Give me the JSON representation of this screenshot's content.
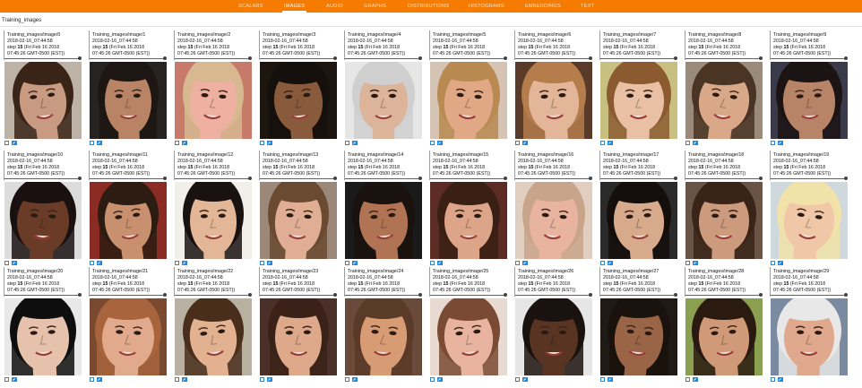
{
  "nav": {
    "tabs": [
      {
        "label": "SCALARS",
        "active": false
      },
      {
        "label": "IMAGES",
        "active": true
      },
      {
        "label": "AUDIO",
        "active": false
      },
      {
        "label": "GRAPHS",
        "active": false
      },
      {
        "label": "DISTRIBUTIONS",
        "active": false
      },
      {
        "label": "HISTOGRAMS",
        "active": false
      },
      {
        "label": "EMBEDDINGS",
        "active": false
      },
      {
        "label": "TEXT",
        "active": false
      }
    ]
  },
  "group": {
    "title": "Training_images"
  },
  "card_common": {
    "wall_time": "2018-02-16_07:44:58",
    "step_label": "step",
    "step_value": "15",
    "time_detail": "(Fri Feb 16 2018",
    "time_zone": "07:45:26 GMT-0500 (EST))"
  },
  "colors": {
    "accent": "#f57c00",
    "control": "#1e88e5"
  },
  "icons": {
    "fit": "expand-icon",
    "actual": "actual-size-icon"
  },
  "cards": [
    {
      "tag": "Training_images/image/0",
      "bg": "#bdb2a6",
      "skin": "#c89a82",
      "hair": "#3a2418"
    },
    {
      "tag": "Training_images/image/1",
      "bg": "#262321",
      "skin": "#b98466",
      "hair": "#1d1612"
    },
    {
      "tag": "Training_images/image/2",
      "bg": "#c87a6a",
      "skin": "#eeb0a0",
      "hair": "#d7b890"
    },
    {
      "tag": "Training_images/image/3",
      "bg": "#1c1510",
      "skin": "#8a5a3c",
      "hair": "#15100c"
    },
    {
      "tag": "Training_images/image/4",
      "bg": "#e6e6e6",
      "skin": "#dcb49a",
      "hair": "#cfcfcf"
    },
    {
      "tag": "Training_images/image/5",
      "bg": "#d5c4b4",
      "skin": "#e0a884",
      "hair": "#b88a52"
    },
    {
      "tag": "Training_images/image/6",
      "bg": "#5a3a28",
      "skin": "#e3b69a",
      "hair": "#b57c4c"
    },
    {
      "tag": "Training_images/image/7",
      "bg": "#c8c080",
      "skin": "#e9c0a4",
      "hair": "#8c5a30"
    },
    {
      "tag": "Training_images/image/8",
      "bg": "#9a8a7a",
      "skin": "#d8a888",
      "hair": "#4a3424"
    },
    {
      "tag": "Training_images/image/9",
      "bg": "#3a3a4a",
      "skin": "#b88468",
      "hair": "#1c1414"
    },
    {
      "tag": "Training_images/image/10",
      "bg": "#dcdcdc",
      "skin": "#6a3c28",
      "hair": "#1a1010"
    },
    {
      "tag": "Training_images/image/11",
      "bg": "#8a2c24",
      "skin": "#c8906e",
      "hair": "#2c1c12"
    },
    {
      "tag": "Training_images/image/12",
      "bg": "#f0efe9",
      "skin": "#e2b696",
      "hair": "#1a1210"
    },
    {
      "tag": "Training_images/image/13",
      "bg": "#9c8878",
      "skin": "#dfae94",
      "hair": "#6a4a30"
    },
    {
      "tag": "Training_images/image/14",
      "bg": "#1a1a1a",
      "skin": "#b07454",
      "hair": "#1a120e"
    },
    {
      "tag": "Training_images/image/15",
      "bg": "#5c2c24",
      "skin": "#dca488",
      "hair": "#3a2014"
    },
    {
      "tag": "Training_images/image/16",
      "bg": "#e0cfc0",
      "skin": "#e8b4a0",
      "hair": "#c8a48a"
    },
    {
      "tag": "Training_images/image/17",
      "bg": "#2a2a2a",
      "skin": "#d8aa8c",
      "hair": "#140e0c"
    },
    {
      "tag": "Training_images/image/18",
      "bg": "#6a5446",
      "skin": "#cc9a7c",
      "hair": "#3a2418"
    },
    {
      "tag": "Training_images/image/19",
      "bg": "#cfd8dc",
      "skin": "#f0c8a8",
      "hair": "#f0e2a8"
    },
    {
      "tag": "Training_images/image/20",
      "bg": "#e8e8e8",
      "skin": "#e6c2ac",
      "hair": "#0e0e0e"
    },
    {
      "tag": "Training_images/image/21",
      "bg": "#7a4a30",
      "skin": "#e2aa8c",
      "hair": "#a8643c"
    },
    {
      "tag": "Training_images/image/22",
      "bg": "#b8b0a0",
      "skin": "#e2b290",
      "hair": "#4a2e1c"
    },
    {
      "tag": "Training_images/image/23",
      "bg": "#4a3028",
      "skin": "#dea88a",
      "hair": "#3a2218"
    },
    {
      "tag": "Training_images/image/24",
      "bg": "#6a4a3a",
      "skin": "#d89c74",
      "hair": "#5a3a28"
    },
    {
      "tag": "Training_images/image/25",
      "bg": "#e8dad0",
      "skin": "#e8b4a0",
      "hair": "#7a4a34"
    },
    {
      "tag": "Training_images/image/26",
      "bg": "#e6e6e6",
      "skin": "#5a3422",
      "hair": "#1a120e"
    },
    {
      "tag": "Training_images/image/27",
      "bg": "#201a16",
      "skin": "#9a6446",
      "hair": "#1a120c"
    },
    {
      "tag": "Training_images/image/28",
      "bg": "#8aa050",
      "skin": "#d09a78",
      "hair": "#2a1a10"
    },
    {
      "tag": "Training_images/image/29",
      "bg": "#7a8aa0",
      "skin": "#e0a88c",
      "hair": "#e8e8e8"
    }
  ]
}
